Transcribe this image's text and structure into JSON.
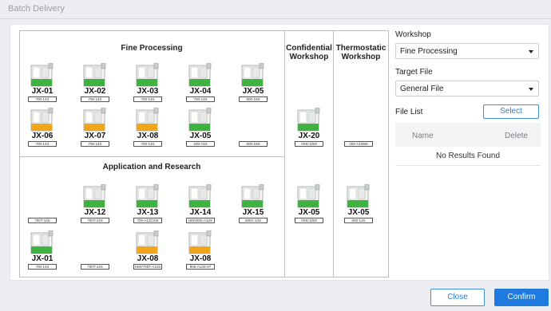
{
  "dialog": {
    "title": "Batch Delivery"
  },
  "floor": {
    "zones": {
      "fine": "Fine Processing",
      "app": "Application and Research",
      "confidential": "Confidential\nWorkshop",
      "thermo": "Thermostatic\nWorkshop"
    },
    "machines": [
      {
        "name": "JX-01",
        "tag": "700-14S",
        "color": "green"
      },
      {
        "name": "JX-02",
        "tag": "700-14S",
        "color": "green"
      },
      {
        "name": "JX-03",
        "tag": "700-14S",
        "color": "green"
      },
      {
        "name": "JX-04",
        "tag": "700-14S",
        "color": "green"
      },
      {
        "name": "JX-05",
        "tag": "800-15S",
        "color": "green"
      },
      {
        "name": "JX-06",
        "tag": "700-14S",
        "color": "orange"
      },
      {
        "name": "JX-07",
        "tag": "700-14S",
        "color": "orange"
      },
      {
        "name": "JX-08",
        "tag": "700-14S",
        "color": "orange"
      },
      {
        "name": "JX-05",
        "tag": "200-A15",
        "color": "green"
      },
      {
        "name": "",
        "tag": "800-15S",
        "color": ""
      },
      {
        "name": "JX-20",
        "tag": "VMC1000",
        "color": "green"
      },
      {
        "name": "",
        "tag": "200-A105M",
        "color": ""
      },
      {
        "name": "",
        "tag": "700T-14S",
        "color": ""
      },
      {
        "name": "JX-12",
        "tag": "700T-14S",
        "color": "green"
      },
      {
        "name": "JX-13",
        "tag": "700-A12CSM",
        "color": "green"
      },
      {
        "name": "JX-14",
        "tag": "HMV500-A12S",
        "color": "green"
      },
      {
        "name": "JX-15",
        "tag": "600A-13S",
        "color": "green"
      },
      {
        "name": "JX-05",
        "tag": "VMC1000",
        "color": "green"
      },
      {
        "name": "JX-05",
        "tag": "600-13S",
        "color": "green"
      },
      {
        "name": "JX-01",
        "tag": "700-14S",
        "color": "green"
      },
      {
        "name": "",
        "tag": "700T-14S",
        "color": ""
      },
      {
        "name": "JX-08",
        "tag": "HMV700T-A12S",
        "color": "orange"
      },
      {
        "name": "JX-08",
        "tag": "900-A13S-07",
        "color": "orange"
      }
    ]
  },
  "side": {
    "workshop_label": "Workshop",
    "workshop_value": "Fine Processing",
    "target_label": "Target File",
    "target_value": "General File",
    "file_list_label": "File List",
    "select_button": "Select",
    "col_name": "Name",
    "col_delete": "Delete",
    "empty_text": "No Results Found"
  },
  "footer": {
    "close": "Close",
    "confirm": "Confirm"
  },
  "colors": {
    "green": "#3fb33f",
    "orange": "#f2a51a",
    "accent": "#1f7ae0"
  }
}
